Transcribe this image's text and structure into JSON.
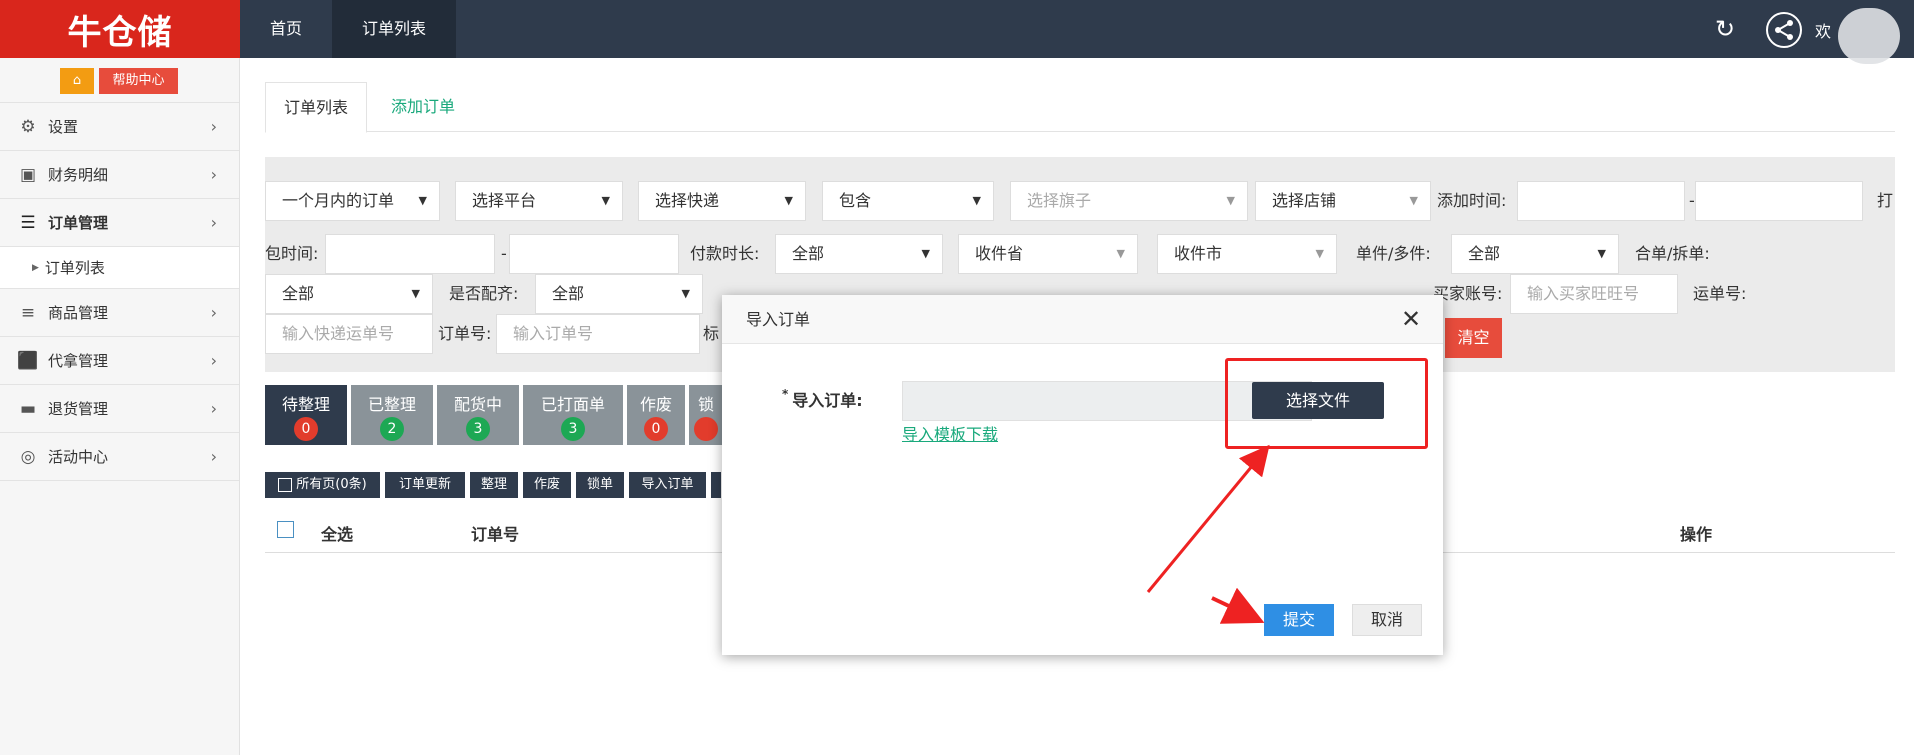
{
  "header": {
    "logo_text": "牛仓储",
    "nav": [
      {
        "label": "首页"
      },
      {
        "label": "订单列表"
      }
    ],
    "welcome": "欢"
  },
  "sidebar": {
    "help_label": "帮助中心",
    "items": [
      {
        "label": "设置"
      },
      {
        "label": "财务明细"
      },
      {
        "label": "订单管理"
      },
      {
        "label": "商品管理"
      },
      {
        "label": "代拿管理"
      },
      {
        "label": "退货管理"
      },
      {
        "label": "活动中心"
      }
    ],
    "sub_item": "订单列表"
  },
  "tabs": {
    "active": "订单列表",
    "add": "添加订单"
  },
  "filters": {
    "time_range": "一个月内的订单",
    "platform": "选择平台",
    "express": "选择快递",
    "contains": "包含",
    "flag_placeholder": "选择旗子",
    "shop": "选择店铺",
    "add_time_label": "添加时间:",
    "print_cut": "打",
    "pack_time_label": "包时间:",
    "pay_duration_label": "付款时长:",
    "pay_duration_value": "全部",
    "province": "收件省",
    "city": "收件市",
    "single_multi_label": "单件/多件:",
    "single_multi_value": "全部",
    "merge_split_label": "合单/拆单:",
    "merge_split_value": "全部",
    "matched_label": "是否配齐:",
    "matched_value": "全部",
    "buyer_label": "买家账号:",
    "buyer_placeholder": "输入买家旺旺号",
    "waybill_label": "运单号:",
    "express_no_placeholder": "输入快递运单号",
    "order_no_label": "订单号:",
    "order_no_placeholder": "输入订单号",
    "mark_cut": "标",
    "dash": "-",
    "clear_label": "清空"
  },
  "status_tabs": [
    {
      "label": "待整理",
      "count": "0",
      "color": "red"
    },
    {
      "label": "已整理",
      "count": "2",
      "color": "green"
    },
    {
      "label": "配货中",
      "count": "3",
      "color": "green"
    },
    {
      "label": "已打面单",
      "count": "3",
      "color": "green"
    },
    {
      "label": "作废",
      "count": "0",
      "color": "red"
    },
    {
      "label": "锁",
      "count": "",
      "color": "red"
    }
  ],
  "actions": {
    "all_pages": "所有页(0条)",
    "update": "订单更新",
    "organize": "整理",
    "void": "作废",
    "lock": "锁单",
    "import": "导入订单"
  },
  "table": {
    "select_all": "全选",
    "order_no": "订单号",
    "operate": "操作"
  },
  "modal": {
    "title": "导入订单",
    "field_required": "*",
    "field_label": "导入订单:",
    "choose_file": "选择文件",
    "template_link": "导入模板下载",
    "submit": "提交",
    "cancel": "取消"
  },
  "colors": {
    "topbar": "#2f3b4c",
    "logo_bg": "#d9261c",
    "accent_green": "#1aa97c",
    "submit_blue": "#2f8fe4",
    "annotation_red": "#ee2222"
  }
}
